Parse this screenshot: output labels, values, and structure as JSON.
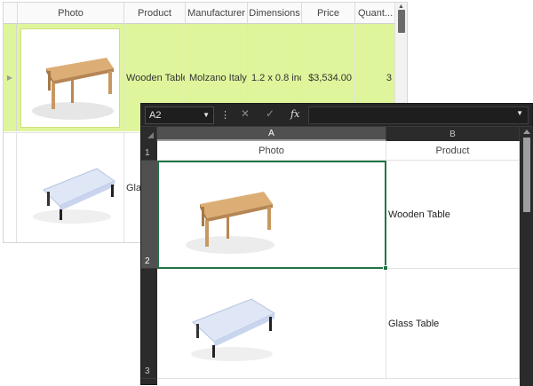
{
  "grid": {
    "columns": [
      "Photo",
      "Product",
      "Manufacturer",
      "Dimensions",
      "Price",
      "Quant..."
    ],
    "rows": [
      {
        "product": "Wooden Table",
        "manufacturer": "Molzano Italy",
        "dimensions": "1.2 x 0.8 inc...",
        "price": "$3,534.00",
        "quantity": "3",
        "photo": "wooden-table"
      },
      {
        "product": "Glas",
        "manufacturer": "",
        "dimensions": "",
        "price": "",
        "quantity": "",
        "photo": "glass-table"
      }
    ],
    "colors": {
      "selected_row": "#dff59c"
    }
  },
  "spreadsheet": {
    "name_box": "A2",
    "formula_icons": {
      "cancel": "✕",
      "enter": "✓",
      "function": "fx"
    },
    "formula_value": "",
    "columns": [
      "A",
      "B"
    ],
    "header_row": {
      "row_number": "1",
      "a": "Photo",
      "b": "Product"
    },
    "rows": [
      {
        "row_number": "2",
        "photo": "wooden-table",
        "product": "Wooden Table"
      },
      {
        "row_number": "3",
        "photo": "glass-table",
        "product": "Glass Table"
      }
    ],
    "colors": {
      "selection": "#217346",
      "background": "#2b2b2b"
    }
  }
}
